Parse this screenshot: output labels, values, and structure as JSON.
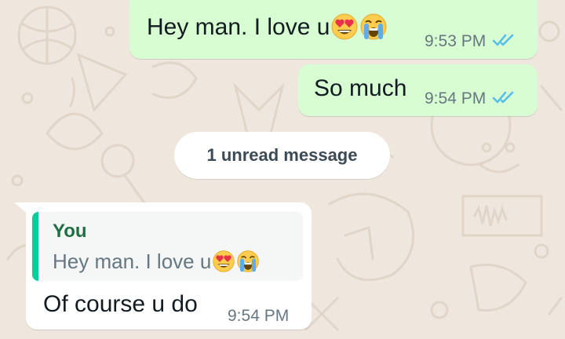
{
  "colors": {
    "outgoing_bubble": "#d9fdd3",
    "incoming_bubble": "#ffffff",
    "read_ticks": "#53bdeb",
    "quote_accent": "#06cf9c",
    "wallpaper": "#efe7dd"
  },
  "messages": [
    {
      "direction": "outgoing",
      "text": "Hey man. I love u",
      "emojis": [
        "smiling-face-with-heart-eyes",
        "loudly-crying-face"
      ],
      "time": "9:53 PM",
      "status": "read"
    },
    {
      "direction": "outgoing",
      "text": "So much",
      "time": "9:54 PM",
      "status": "read"
    },
    {
      "direction": "incoming",
      "reply_to": {
        "author": "You",
        "text": "Hey man. I love u",
        "emojis": [
          "smiling-face-with-heart-eyes",
          "loudly-crying-face"
        ]
      },
      "text": "Of course u do",
      "time": "9:54 PM"
    }
  ],
  "unread_divider": "1 unread message",
  "icons": [
    "double-check-read-icon",
    "heart-eyes-emoji",
    "crying-emoji"
  ]
}
